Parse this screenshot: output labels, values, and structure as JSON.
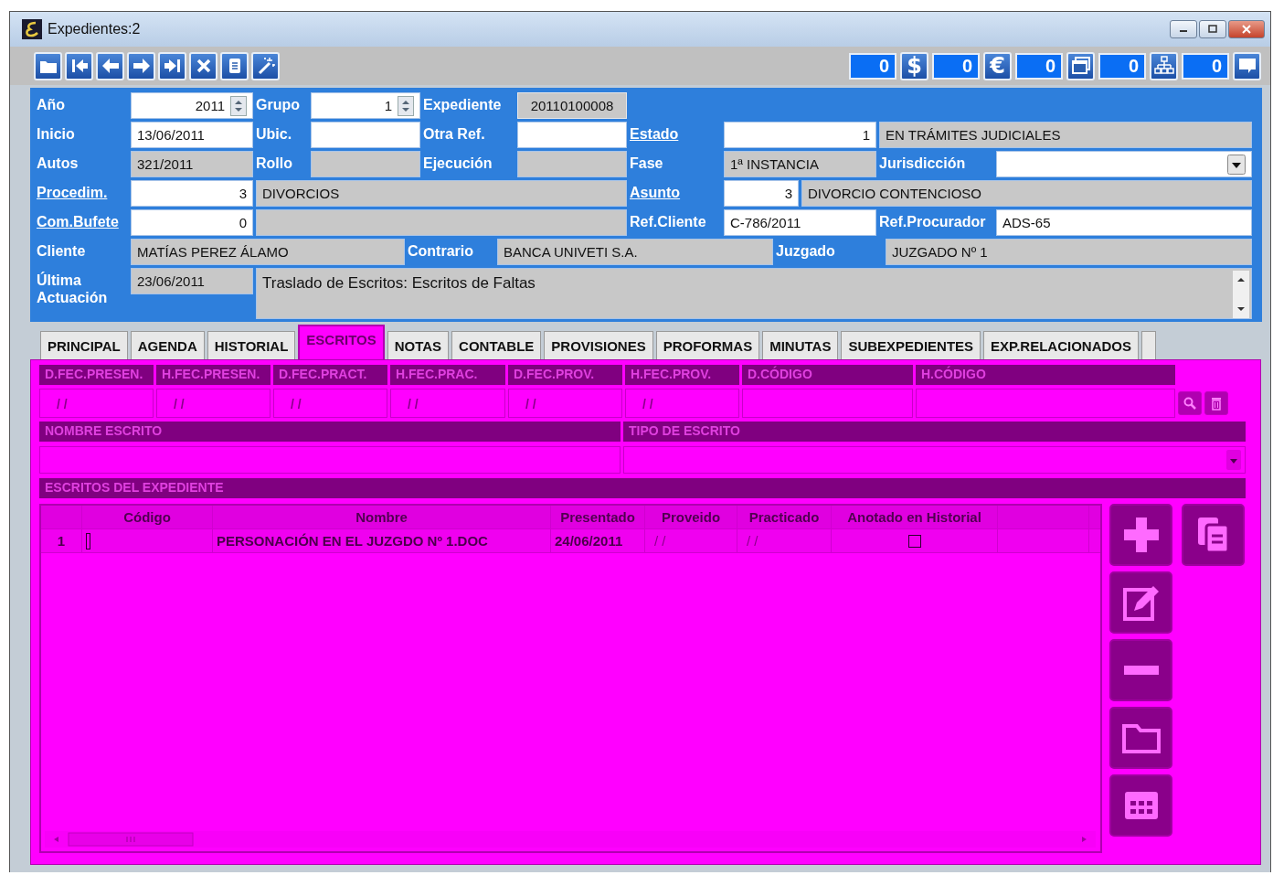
{
  "window": {
    "title": "Expedientes:2"
  },
  "counters": [
    {
      "value": "0",
      "kind": "symbol",
      "symbol": "$"
    },
    {
      "value": "0",
      "kind": "symbol",
      "symbol": "€"
    },
    {
      "value": "0",
      "kind": "windows"
    },
    {
      "value": "0",
      "kind": "hierarchy"
    },
    {
      "value": "0",
      "kind": "comment"
    }
  ],
  "form": {
    "rows": [
      {
        "fields": [
          {
            "label": "Año",
            "link": false,
            "kind": "spinner",
            "value": "2011",
            "editable": true
          },
          {
            "label": "Grupo",
            "link": false,
            "kind": "spinner",
            "value": "1",
            "editable": true
          },
          {
            "label": "Expediente",
            "link": false,
            "kind": "code",
            "value": "20110100008",
            "editable": false
          }
        ]
      },
      {
        "fields": [
          {
            "label": "Inicio",
            "link": false,
            "kind": "text",
            "value": "13/06/2011",
            "editable": true
          },
          {
            "label": "Ubic.",
            "link": false,
            "kind": "text",
            "editable": true
          },
          {
            "label": "Otra Ref.",
            "link": false,
            "kind": "text",
            "editable": true
          },
          {
            "label": "Estado",
            "link": true,
            "kind": "number",
            "value": "1",
            "editable": true
          },
          {
            "kind": "text",
            "value": "EN TRÁMITES JUDICIALES",
            "editable": false
          }
        ]
      },
      {
        "fields": [
          {
            "label": "Autos",
            "link": false,
            "kind": "text",
            "value": "321/2011",
            "editable": false
          },
          {
            "label": "Rollo",
            "link": false,
            "kind": "text",
            "editable": false
          },
          {
            "label": "Ejecución",
            "link": false,
            "kind": "text",
            "editable": false
          },
          {
            "label": "Fase",
            "link": false,
            "kind": "text",
            "value": "1ª INSTANCIA",
            "editable": false
          },
          {
            "label": "Jurisdicción",
            "link": false,
            "kind": "dropdown",
            "editable": true
          }
        ]
      },
      {
        "fields": [
          {
            "label": "Procedim.",
            "link": true,
            "kind": "number",
            "value": "3",
            "editable": true
          },
          {
            "kind": "text",
            "value": "DIVORCIOS",
            "editable": false
          },
          {
            "label": "Asunto",
            "link": true,
            "kind": "number",
            "value": "3",
            "editable": true
          },
          {
            "kind": "text",
            "value": "DIVORCIO CONTENCIOSO",
            "editable": false
          }
        ]
      },
      {
        "fields": [
          {
            "label": "Com.Bufete",
            "link": true,
            "kind": "number",
            "value": "0",
            "editable": true
          },
          {
            "kind": "text",
            "editable": false
          },
          {
            "label": "Ref.Cliente",
            "link": false,
            "kind": "text",
            "value": "C-786/2011",
            "editable": true
          },
          {
            "label": "Ref.Procurador",
            "link": false,
            "kind": "text",
            "value": "ADS-65",
            "editable": true
          }
        ]
      },
      {
        "fields": [
          {
            "label": "Cliente",
            "link": false,
            "kind": "text",
            "value": "MATÍAS PEREZ ÁLAMO",
            "editable": false
          },
          {
            "label": "Contrario",
            "link": false,
            "kind": "text",
            "value": "BANCA UNIVETI S.A.",
            "editable": false
          },
          {
            "label": "Juzgado",
            "link": false,
            "kind": "text",
            "value": "JUZGADO Nº 1",
            "editable": false
          }
        ]
      },
      {
        "fields": [
          {
            "label": "Última Actuación",
            "link": false,
            "kind": "text",
            "value": "23/06/2011",
            "editable": false
          },
          {
            "kind": "memo",
            "value": "Traslado de Escritos: Escritos de Faltas",
            "editable": false
          }
        ]
      }
    ]
  },
  "tabs": [
    {
      "label": "PRINCIPAL",
      "selected": false
    },
    {
      "label": "AGENDA",
      "selected": false
    },
    {
      "label": "HISTORIAL",
      "selected": false
    },
    {
      "label": "ESCRITOS",
      "selected": true
    },
    {
      "label": "NOTAS",
      "selected": false
    },
    {
      "label": "CONTABLE",
      "selected": false
    },
    {
      "label": "PROVISIONES",
      "selected": false
    },
    {
      "label": "PROFORMAS",
      "selected": false
    },
    {
      "label": "MINUTAS",
      "selected": false
    },
    {
      "label": "SUBEXPEDIENTES",
      "selected": false
    },
    {
      "label": "EXP.RELACIONADOS",
      "selected": false
    }
  ],
  "filters": {
    "columns": [
      {
        "label": "D.FEC.PRESEN.",
        "value": "/ /"
      },
      {
        "label": "H.FEC.PRESEN.",
        "value": "/ /"
      },
      {
        "label": "D.FEC.PRACT.",
        "value": "/ /"
      },
      {
        "label": "H.FEC.PRAC.",
        "value": "/ /"
      },
      {
        "label": "D.FEC.PROV.",
        "value": "/ /"
      },
      {
        "label": "H.FEC.PROV.",
        "value": "/ /"
      },
      {
        "label": "D.CÓDIGO"
      },
      {
        "label": "H.CÓDIGO"
      }
    ],
    "name_label": "NOMBRE ESCRITO",
    "type_label": "TIPO DE ESCRITO"
  },
  "escritos": {
    "title": "ESCRITOS DEL EXPEDIENTE",
    "columns": [
      "Código",
      "Nombre",
      "Presentado",
      "Proveido",
      "Practicado",
      "Anotado en Historial"
    ],
    "rows": [
      {
        "number": "1",
        "nombre": "PERSONACIÓN EN EL JUZGDO Nº 1.DOC",
        "presentado": "24/06/2011",
        "proveido": "/ /",
        "practicado": "/ /",
        "anotado": false
      }
    ]
  }
}
